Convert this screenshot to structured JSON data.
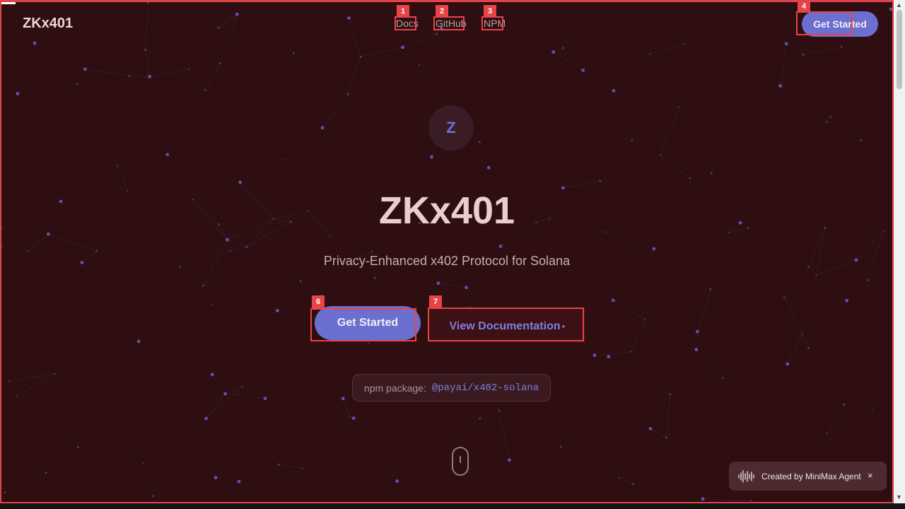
{
  "header": {
    "brand": "ZKx401",
    "nav": [
      {
        "label": "Docs"
      },
      {
        "label": "GitHub"
      },
      {
        "label": "NPM"
      }
    ],
    "cta_label": "Get Started"
  },
  "hero": {
    "logo_letter": "Z",
    "title": "ZKx401",
    "subtitle": "Privacy-Enhanced x402 Protocol for Solana",
    "primary_cta": "Get Started",
    "secondary_cta": "View Documentation",
    "secondary_mark": "●"
  },
  "npm": {
    "label": "npm package:",
    "package_name": "@payai/x402-solana"
  },
  "badge": {
    "text": "Created by MiniMax Agent",
    "close": "×"
  },
  "annotations": [
    {
      "label": "1",
      "target": "nav-docs"
    },
    {
      "label": "2",
      "target": "nav-github"
    },
    {
      "label": "3",
      "target": "nav-npm"
    },
    {
      "label": "4",
      "target": "header-get-started-button"
    },
    {
      "label": "6",
      "target": "hero-get-started-button"
    },
    {
      "label": "7",
      "target": "view-documentation-button"
    }
  ],
  "theme": {
    "background": "#2e0e10",
    "accent": "#6b6fd0",
    "accent_text": "#7c80e0",
    "annotation": "#e84448",
    "particle": "#6a6ee0"
  },
  "scrollbar": {
    "up": "▲",
    "down": "▼"
  }
}
